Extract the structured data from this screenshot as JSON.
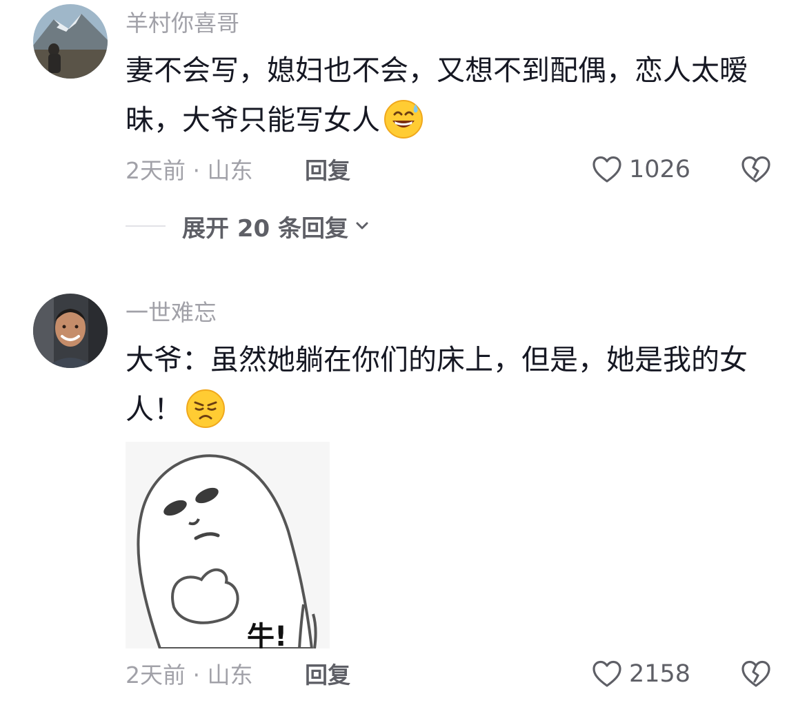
{
  "comments": [
    {
      "username": "羊村你喜哥",
      "text": "妻不会写，媳妇也不会，又想不到配偶，恋人太暧昧，大爷只能写女人",
      "emoji": "grinning-sweat-emoji",
      "time": "2天前 · 山东",
      "reply_label": "回复",
      "likes": "1026",
      "expand_label": "展开 20 条回复"
    },
    {
      "username": "一世难忘",
      "text": "大爷：虽然她躺在你们的床上，但是，她是我的女人！",
      "emoji": "annoyed-emoji",
      "sticker_caption": "牛!",
      "time": "2天前 · 山东",
      "reply_label": "回复",
      "likes": "2158"
    }
  ],
  "colors": {
    "primary_text": "#161823",
    "secondary_text": "#a1a1a8",
    "action_text": "#5e5f66"
  },
  "icons": {
    "like": "heart-outline-icon",
    "dislike": "broken-heart-icon",
    "expand": "chevron-down-icon"
  }
}
